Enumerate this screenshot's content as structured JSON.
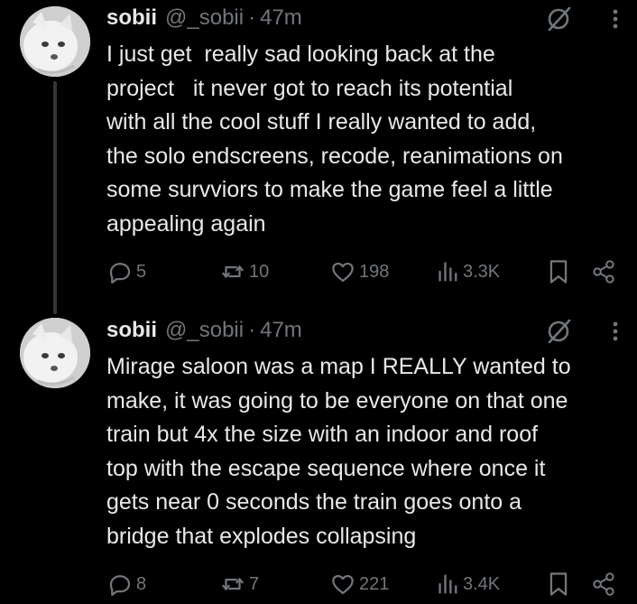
{
  "colors": {
    "background": "#000000",
    "text_primary": "#e7e9ea",
    "text_secondary": "#71767b",
    "thread_line": "#333639"
  },
  "tweets": [
    {
      "display_name": "sobii",
      "handle": "@_sobii",
      "separator": "·",
      "time": "47m",
      "text": "I just get  really sad looking back at the\nproject   it never got to reach its potential\nwith all the cool stuff I really wanted to add,\nthe solo endscreens, recode, reanimations on\nsome survviors to make the game feel a little\nappealing again",
      "replies": "5",
      "reposts": "10",
      "likes": "198",
      "views": "3.3K",
      "icons": [
        "reply-icon",
        "repost-icon",
        "like-icon",
        "views-icon",
        "bookmark-icon",
        "share-icon",
        "grok-icon",
        "more-icon"
      ]
    },
    {
      "display_name": "sobii",
      "handle": "@_sobii",
      "separator": "·",
      "time": "47m",
      "text": "Mirage saloon was a map I REALLY wanted to\nmake, it was going to be everyone on that one\ntrain but 4x the size with an indoor and roof\ntop with the escape sequence where once it\ngets near 0 seconds the train goes onto a\nbridge that explodes collapsing",
      "replies": "8",
      "reposts": "7",
      "likes": "221",
      "views": "3.4K",
      "icons": [
        "reply-icon",
        "repost-icon",
        "like-icon",
        "views-icon",
        "bookmark-icon",
        "share-icon",
        "grok-icon",
        "more-icon"
      ]
    }
  ]
}
